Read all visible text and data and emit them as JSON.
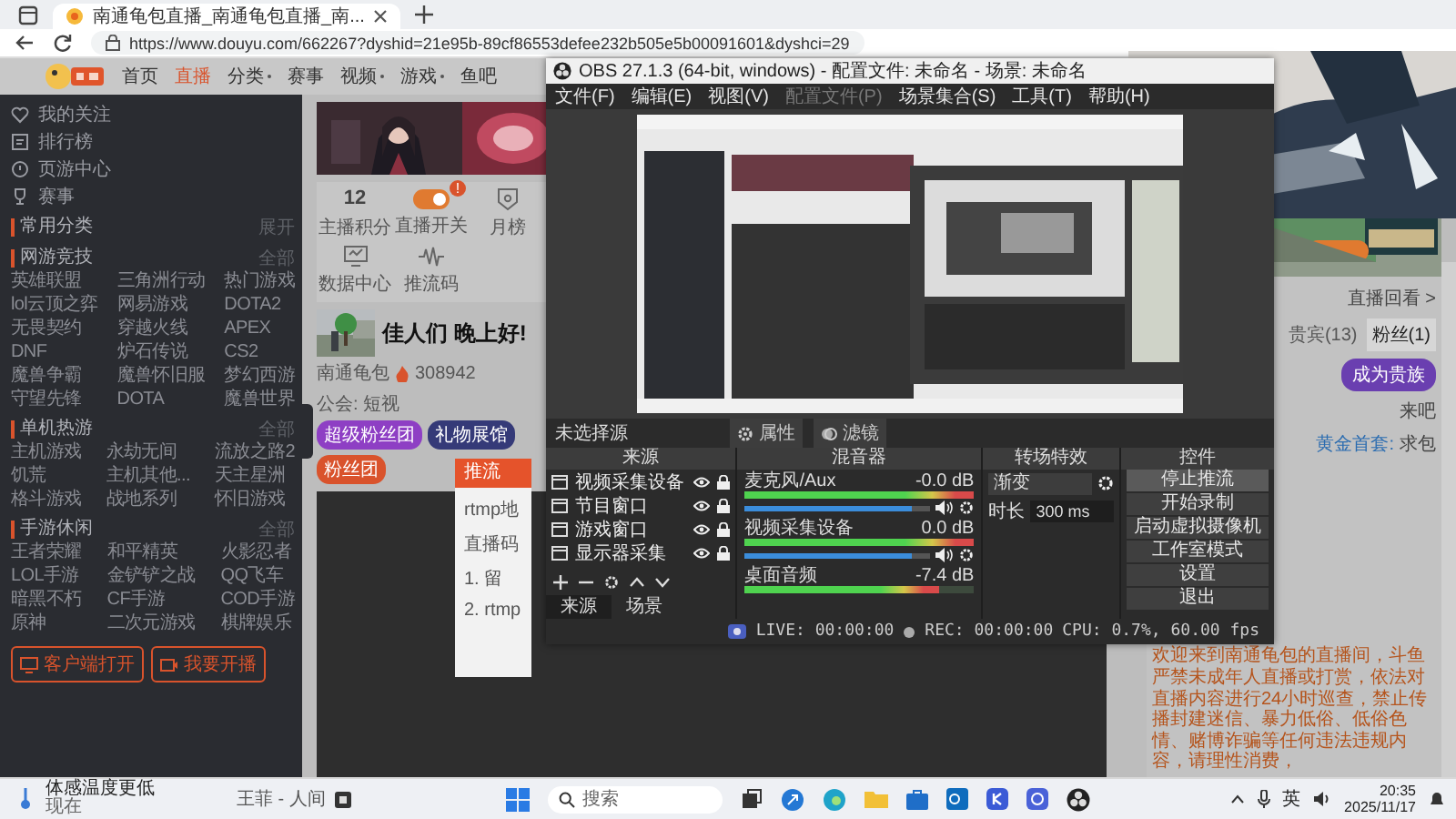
{
  "browser": {
    "tab": {
      "title": "南通龟包直播_南通龟包直播_南..."
    },
    "url": "https://www.douyu.com/662267?dyshid=21e95b-89cf86553defee232b505e5b00091601&dyshci=29"
  },
  "site_nav": [
    {
      "label": "首页",
      "selected": false,
      "dropdown": false
    },
    {
      "label": "直播",
      "selected": true,
      "dropdown": false
    },
    {
      "label": "分类",
      "selected": false,
      "dropdown": true
    },
    {
      "label": "赛事",
      "selected": false,
      "dropdown": false
    },
    {
      "label": "视频",
      "selected": false,
      "dropdown": true
    },
    {
      "label": "游戏",
      "selected": false,
      "dropdown": true
    },
    {
      "label": "鱼吧",
      "selected": false,
      "dropdown": false
    }
  ],
  "sidebar": {
    "links": [
      "我的关注",
      "排行榜",
      "页游中心",
      "赛事"
    ],
    "sections": [
      {
        "title": "常用分类",
        "more": "展开"
      },
      {
        "title": "网游竞技",
        "more": "全部",
        "items": [
          "英雄联盟",
          "三角洲行动",
          "热门游戏",
          "lol云顶之弈",
          "网易游戏",
          "DOTA2",
          "无畏契约",
          "穿越火线",
          "APEX",
          "DNF",
          "炉石传说",
          "CS2",
          "魔兽争霸",
          "魔兽怀旧服",
          "梦幻西游",
          "守望先锋",
          "DOTA",
          "魔兽世界"
        ]
      },
      {
        "title": "单机热游",
        "more": "全部",
        "items": [
          "主机游戏",
          "永劫无间",
          "流放之路2",
          "饥荒",
          "主机其他...",
          "天主星洲",
          "格斗游戏",
          "战地系列",
          "怀旧游戏"
        ]
      },
      {
        "title": "手游休闲",
        "more": "全部",
        "items": [
          "王者荣耀",
          "和平精英",
          "火影忍者",
          "LOL手游",
          "金铲铲之战",
          "QQ飞车",
          "暗黑不朽",
          "CF手游",
          "COD手游",
          "原神",
          "二次元游戏",
          "棋牌娱乐"
        ]
      }
    ],
    "buttons": [
      "客户端打开",
      "我要开播"
    ]
  },
  "stats": [
    {
      "kind": "number",
      "value": "12",
      "label": "主播积分"
    },
    {
      "kind": "toggle",
      "on": true,
      "badge": "!",
      "label": "直播开关"
    },
    {
      "kind": "icon",
      "label": "月榜"
    },
    {
      "kind": "icon",
      "label": "数据中心"
    },
    {
      "kind": "icon",
      "label": "推流码"
    }
  ],
  "stream": {
    "title": "佳人们 晚上好!",
    "streamer": "南通龟包",
    "heat": "308942",
    "guild": "公会: 短视",
    "tags": [
      {
        "label": "超级粉丝团",
        "color": "#8e3fc4"
      },
      {
        "label": "礼物展馆",
        "color": "#353a78"
      },
      {
        "label": "粉丝团",
        "color": "#d9532c"
      }
    ]
  },
  "modal": {
    "title": "推流",
    "lines": [
      "rtmp地",
      "直播码",
      "1. 留",
      "2. rtmp"
    ]
  },
  "right_column": {
    "replay": "直播回看 >",
    "tabs": [
      {
        "label": "贵宾(13)",
        "selected": false
      },
      {
        "label": "粉丝(1)",
        "selected": true
      }
    ],
    "badge": "成为贵族",
    "messages": [
      {
        "text": "来吧"
      },
      {
        "user": "黄金首套:",
        "text": "求包"
      }
    ],
    "notice": "欢迎来到南通龟包的直播间，斗鱼严禁未成年人直播或打赏，依法对直播内容进行24小时巡查，禁止传播封建迷信、暴力低俗、低俗色情、赌博诈骗等任何违法违规内容，请理性消费，"
  },
  "obs": {
    "title": "OBS 27.1.3 (64-bit, windows) - 配置文件: 未命名 - 场景: 未命名",
    "menu": [
      {
        "label": "文件(F)",
        "disabled": false
      },
      {
        "label": "编辑(E)",
        "disabled": false
      },
      {
        "label": "视图(V)",
        "disabled": false
      },
      {
        "label": "配置文件(P)",
        "disabled": true
      },
      {
        "label": "场景集合(S)",
        "disabled": false
      },
      {
        "label": "工具(T)",
        "disabled": false
      },
      {
        "label": "帮助(H)",
        "disabled": false
      }
    ],
    "no_source": "未选择源",
    "source_buttons": [
      "属性",
      "滤镜"
    ],
    "sources": {
      "title": "来源",
      "items": [
        "视频采集设备",
        "节目窗口",
        "游戏窗口",
        "显示器采集"
      ],
      "tabs": [
        {
          "label": "来源",
          "selected": true
        },
        {
          "label": "场景",
          "selected": false
        }
      ]
    },
    "mixer": {
      "title": "混音器",
      "channels": [
        {
          "name": "麦克风/Aux",
          "reading": "-0.0 dB",
          "meter": {
            "level": 1.0
          },
          "fader": {
            "level": 0.9
          }
        },
        {
          "name": "视频采集设备",
          "reading": "0.0 dB",
          "meter": {
            "level": 1.0
          },
          "fader": {
            "level": 0.9
          }
        },
        {
          "name": "桌面音频",
          "reading": "-7.4 dB",
          "meter": {
            "level": 0.85
          }
        }
      ]
    },
    "transitions": {
      "title": "转场特效",
      "type": "渐变",
      "duration_label": "时长",
      "duration": "300 ms"
    },
    "controls": {
      "title": "控件",
      "buttons": [
        {
          "label": "停止推流",
          "hover": true
        },
        {
          "label": "开始录制",
          "hover": false
        },
        {
          "label": "启动虚拟摄像机",
          "hover": false
        },
        {
          "label": "工作室模式",
          "hover": false
        },
        {
          "label": "设置",
          "hover": false
        },
        {
          "label": "退出",
          "hover": false
        }
      ]
    },
    "status": {
      "live": "LIVE: 00:00:00",
      "rec": "REC: 00:00:00",
      "cpu": "CPU: 0.7%, 60.00 fps"
    }
  },
  "taskbar": {
    "weather": {
      "title": "体感温度更低",
      "subtitle": "现在"
    },
    "media": "王菲 - 人间",
    "search": {
      "placeholder": "搜索"
    },
    "ime": "英",
    "time": "20:35",
    "date": "2025/11/17"
  }
}
